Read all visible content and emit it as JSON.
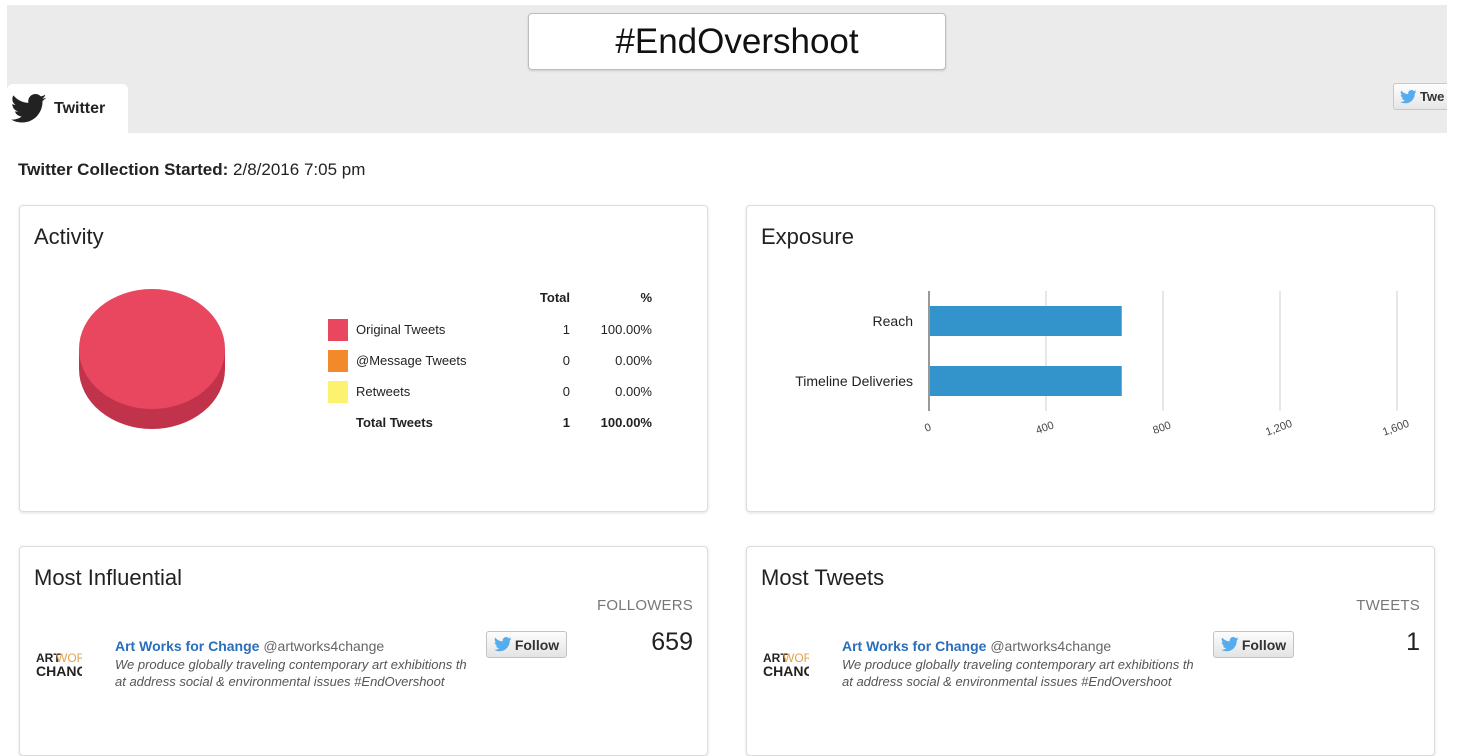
{
  "hashtag": "#EndOvershoot",
  "tab": {
    "label": "Twitter"
  },
  "tweet_button_label": "Twe",
  "collection": {
    "label": "Twitter Collection Started:",
    "value": "2/8/2016 7:05 pm"
  },
  "activity": {
    "title": "Activity",
    "headers": {
      "total": "Total",
      "pct": "%"
    },
    "rows": [
      {
        "label": "Original Tweets",
        "total": "1",
        "pct": "100.00%",
        "color": "#e8475f"
      },
      {
        "label": "@Message Tweets",
        "total": "0",
        "pct": "0.00%",
        "color": "#f28a2c"
      },
      {
        "label": "Retweets",
        "total": "0",
        "pct": "0.00%",
        "color": "#fdf26f"
      }
    ],
    "total_row": {
      "label": "Total Tweets",
      "total": "1",
      "pct": "100.00%"
    }
  },
  "exposure": {
    "title": "Exposure"
  },
  "chart_data": {
    "type": "bar",
    "orientation": "horizontal",
    "categories": [
      "Reach",
      "Timeline Deliveries"
    ],
    "values": [
      659,
      659
    ],
    "xticks": [
      "0",
      "400",
      "800",
      "1,200",
      "1,600"
    ],
    "xlim": [
      0,
      1600
    ],
    "grid": true,
    "color": "#3394cc"
  },
  "most_influential": {
    "title": "Most Influential",
    "column": "FOLLOWERS",
    "value": "659",
    "user": {
      "name": "Art Works for Change",
      "handle": "@artworks4change",
      "desc_line1": "We produce globally traveling contemporary art exhibitions th",
      "desc_line2": "at address social & environmental issues #EndOvershoot",
      "logo_line1a": "ART",
      "logo_line1b": "WORKS",
      "logo_line2": "CHANGE"
    },
    "follow_label": "Follow"
  },
  "most_tweets": {
    "title": "Most Tweets",
    "column": "TWEETS",
    "value": "1",
    "user": {
      "name": "Art Works for Change",
      "handle": "@artworks4change",
      "desc_line1": "We produce globally traveling contemporary art exhibitions th",
      "desc_line2": "at address social & environmental issues #EndOvershoot",
      "logo_line1a": "ART",
      "logo_line1b": "WORKS",
      "logo_line2": "CHANGE"
    },
    "follow_label": "Follow"
  },
  "colors": {
    "twitter_blue": "#55acee",
    "pie_top": "#e8475f",
    "pie_side": "#c0334a",
    "bar": "#3394cc",
    "link": "#2a6ebb"
  }
}
